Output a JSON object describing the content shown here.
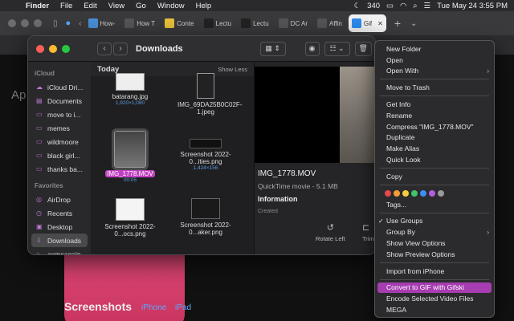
{
  "menubar": {
    "app": "Finder",
    "items": [
      "File",
      "Edit",
      "View",
      "Go",
      "Window",
      "Help"
    ],
    "battery": "340",
    "datetime": "Tue May 24  3:55 PM"
  },
  "browser": {
    "tabs": [
      {
        "label": "How-",
        "icon": "question-favicon",
        "color": "#4a8fd8"
      },
      {
        "label": "How T",
        "icon": "triangle-favicon",
        "color": "#555"
      },
      {
        "label": "Conte",
        "icon": "square-favicon",
        "color": "#e8c23a"
      },
      {
        "label": "Lectu",
        "icon": "bb-favicon",
        "color": "#222"
      },
      {
        "label": "Lectu",
        "icon": "bb-favicon",
        "color": "#222"
      },
      {
        "label": "DC Ar",
        "icon": "wordpress-favicon",
        "color": "#555"
      },
      {
        "label": "Affin",
        "icon": "triangle-favicon",
        "color": "#555"
      },
      {
        "label": "Gif",
        "icon": "appstore-favicon",
        "color": "#2d8cf0"
      }
    ],
    "active_tab": "Gif"
  },
  "webpage": {
    "partial_heading": "Ap",
    "screenshots_title": "Screenshots",
    "device_tabs": [
      "iPhone",
      "iPad"
    ]
  },
  "finder": {
    "title": "Downloads",
    "sidebar": {
      "icloud_header": "iCloud",
      "icloud_items": [
        "iCloud Dri...",
        "Documents",
        "move to i...",
        "memes",
        "wildmoore",
        "black girl...",
        "thanks ba..."
      ],
      "favorites_header": "Favorites",
      "favorites_items": [
        "AirDrop",
        "Recents",
        "Desktop",
        "Downloads",
        "axmeagain"
      ],
      "selected": "Downloads"
    },
    "filepane": {
      "section": "Today",
      "show_less": "Show Less",
      "files": [
        {
          "name": "batarang.jpg",
          "sub": "1,920×1,080"
        },
        {
          "name": "IMG_69DA25B0C02F-1.jpeg",
          "sub": ""
        },
        {
          "name": "IMG_1778.MOV",
          "sub": "00:05"
        },
        {
          "name": "Screenshot 2022-0...ities.png",
          "sub": "1,424×156"
        },
        {
          "name": "Screenshot 2022-0...ocs.png",
          "sub": ""
        },
        {
          "name": "Screenshot 2022-0...aker.png",
          "sub": ""
        }
      ],
      "selected_file": "IMG_1778.MOV"
    },
    "preview": {
      "filename": "IMG_1778.MOV",
      "kind": "QuickTime movie - 5.1 MB",
      "info_header": "Information",
      "created_label": "Created",
      "actions": [
        "Rotate Left",
        "Trim"
      ]
    }
  },
  "context_menu": {
    "group1": [
      "New Folder",
      "Open",
      "Open With"
    ],
    "group2": [
      "Move to Trash"
    ],
    "group3": [
      "Get Info",
      "Rename",
      "Compress \"IMG_1778.MOV\"",
      "Duplicate",
      "Make Alias",
      "Quick Look"
    ],
    "group4": [
      "Copy"
    ],
    "tag_colors": [
      "#e5484d",
      "#f29d38",
      "#f2cf3a",
      "#3fc46a",
      "#3a8ef6",
      "#b35ee0",
      "#9a9a9e"
    ],
    "tags_label": "Tags...",
    "group5": [
      "Use Groups",
      "Group By",
      "Show View Options",
      "Show Preview Options"
    ],
    "group6": [
      "Import from iPhone"
    ],
    "group7": [
      "Convert to GIF with Gifski",
      "Encode Selected Video Files",
      "MEGA"
    ],
    "highlighted": "Convert to GIF with Gifski"
  }
}
